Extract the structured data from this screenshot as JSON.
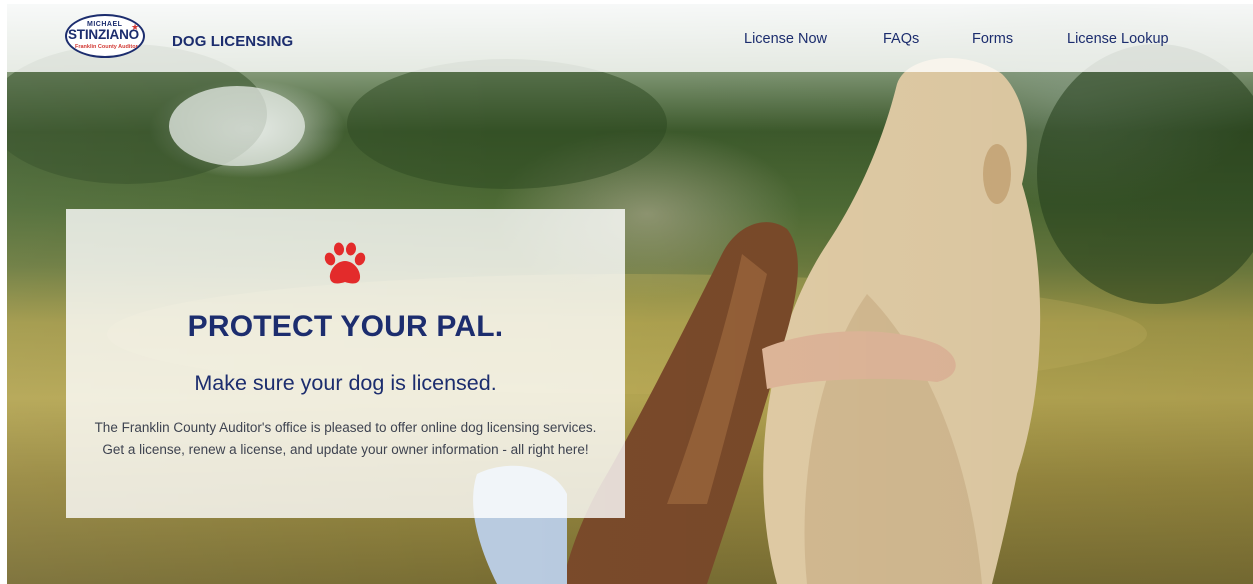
{
  "header": {
    "logo": {
      "first_name": "MICHAEL",
      "last_name": "STINZIANO",
      "subtitle": "Franklin County Auditor"
    },
    "brand": "DOG LICENSING",
    "nav": [
      {
        "label": "License Now"
      },
      {
        "label": "FAQs"
      },
      {
        "label": "Forms"
      },
      {
        "label": "License Lookup"
      }
    ]
  },
  "hero": {
    "headline": "PROTECT YOUR PAL.",
    "subheadline": "Make sure your dog is licensed.",
    "body": "The Franklin County Auditor's office is pleased to offer online dog licensing services. Get a license, renew a license, and update your owner information - all right here!",
    "paw_icon": "paw-icon"
  },
  "colors": {
    "navy": "#1c2d6e",
    "accent_red": "#e32b2b"
  }
}
